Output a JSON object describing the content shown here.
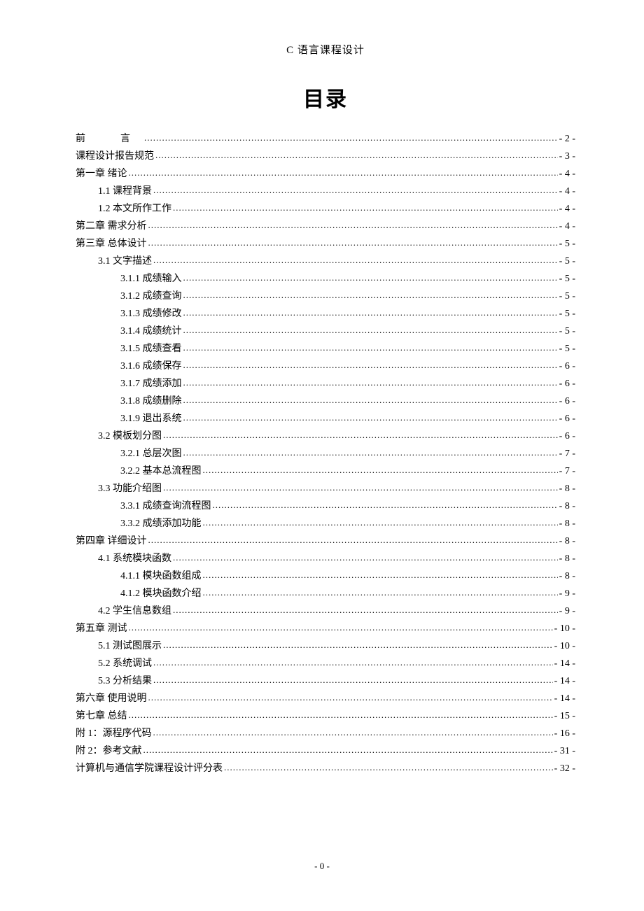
{
  "header": "C 语言课程设计",
  "title": "目录",
  "footer": "- 0 -",
  "toc": [
    {
      "indent": 0,
      "label": "前　言",
      "page": "- 2 -",
      "preface": true
    },
    {
      "indent": 0,
      "label": "课程设计报告规范",
      "page": "- 3 -"
    },
    {
      "indent": 0,
      "label": "第一章 绪论",
      "page": "- 4 -"
    },
    {
      "indent": 1,
      "label": "1.1 课程背景",
      "page": "- 4 -"
    },
    {
      "indent": 1,
      "label": "1.2 本文所作工作",
      "page": "- 4 -"
    },
    {
      "indent": 0,
      "label": "第二章 需求分析",
      "page": "- 4 -"
    },
    {
      "indent": 0,
      "label": "第三章 总体设计",
      "page": "- 5 -"
    },
    {
      "indent": 1,
      "label": "3.1 文字描述",
      "page": "- 5 -"
    },
    {
      "indent": 2,
      "label": "3.1.1 成绩输入",
      "page": "- 5 -"
    },
    {
      "indent": 2,
      "label": "3.1.2 成绩查询",
      "page": "- 5 -"
    },
    {
      "indent": 2,
      "label": "3.1.3 成绩修改",
      "page": "- 5 -"
    },
    {
      "indent": 2,
      "label": "3.1.4 成绩统计",
      "page": "- 5 -"
    },
    {
      "indent": 2,
      "label": "3.1.5 成绩查看",
      "page": "- 5 -"
    },
    {
      "indent": 2,
      "label": "3.1.6 成绩保存",
      "page": "- 6 -"
    },
    {
      "indent": 2,
      "label": "3.1.7 成绩添加",
      "page": "- 6 -"
    },
    {
      "indent": 2,
      "label": "3.1.8 成绩删除",
      "page": "- 6 -"
    },
    {
      "indent": 2,
      "label": "3.1.9 退出系统",
      "page": "- 6 -"
    },
    {
      "indent": 1,
      "label": "3.2 模板划分图",
      "page": "- 6 -"
    },
    {
      "indent": 2,
      "label": "3.2.1 总层次图",
      "page": "- 7 -"
    },
    {
      "indent": 2,
      "label": "3.2.2 基本总流程图",
      "page": "- 7 -"
    },
    {
      "indent": 1,
      "label": "3.3 功能介绍图",
      "page": "- 8 -"
    },
    {
      "indent": 2,
      "label": "3.3.1 成绩查询流程图",
      "page": "- 8 -"
    },
    {
      "indent": 2,
      "label": "3.3.2 成绩添加功能",
      "page": "- 8 -"
    },
    {
      "indent": 0,
      "label": "第四章 详细设计",
      "page": "- 8 -"
    },
    {
      "indent": 1,
      "label": "4.1 系统模块函数",
      "page": "- 8 -"
    },
    {
      "indent": 2,
      "label": "4.1.1 模块函数组成",
      "page": "- 8 -"
    },
    {
      "indent": 2,
      "label": "4.1.2 模块函数介绍",
      "page": "- 9 -"
    },
    {
      "indent": 1,
      "label": "4.2 学生信息数组",
      "page": "- 9 -"
    },
    {
      "indent": 0,
      "label": "第五章 测试",
      "page": "- 10 -"
    },
    {
      "indent": 1,
      "label": "5.1 测试图展示",
      "page": "- 10 -"
    },
    {
      "indent": 1,
      "label": "5.2 系统调试",
      "page": "- 14 -"
    },
    {
      "indent": 1,
      "label": "5.3 分析结果",
      "page": "- 14 -"
    },
    {
      "indent": 0,
      "label": "第六章 使用说明",
      "page": "- 14 -"
    },
    {
      "indent": 0,
      "label": "第七章 总结",
      "page": "- 15 -"
    },
    {
      "indent": 0,
      "label": "附 1：源程序代码",
      "page": "- 16 -"
    },
    {
      "indent": 0,
      "label": "附 2：参考文献",
      "page": "- 31 -"
    },
    {
      "indent": 0,
      "label": "计算机与通信学院课程设计评分表",
      "page": "- 32 -"
    }
  ]
}
